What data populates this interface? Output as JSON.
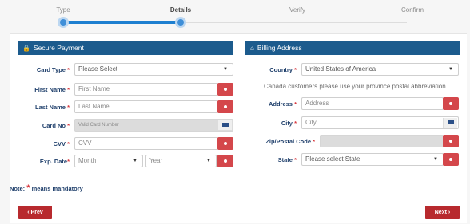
{
  "stepper": {
    "steps": [
      {
        "label": "Type"
      },
      {
        "label": "Details"
      },
      {
        "label": "Verify"
      },
      {
        "label": "Confirm"
      }
    ]
  },
  "payment": {
    "header": "Secure Payment",
    "card_type": {
      "label": "Card Type",
      "value": "Please Select"
    },
    "first_name": {
      "label": "First Name",
      "placeholder": "First Name"
    },
    "last_name": {
      "label": "Last Name",
      "placeholder": "Last Name"
    },
    "card_no": {
      "label": "Card No",
      "placeholder": "Valid Card Number"
    },
    "cvv": {
      "label": "CVV",
      "placeholder": "CVV"
    },
    "exp_date": {
      "label": "Exp. Date",
      "month": "Month",
      "year": "Year"
    }
  },
  "billing": {
    "header": "Billing Address",
    "country": {
      "label": "Country",
      "value": "United States of America"
    },
    "hint": "Canada customers please use your province postal abbreviation",
    "address": {
      "label": "Address",
      "placeholder": "Address"
    },
    "city": {
      "label": "City",
      "placeholder": "City"
    },
    "zip": {
      "label": "Zip/Postal Code"
    },
    "state": {
      "label": "State",
      "value": "Please select State"
    }
  },
  "note": {
    "prefix": "Note:",
    "star": "*",
    "suffix": "means mandatory"
  },
  "nav": {
    "prev": "Prev",
    "next": "Next"
  },
  "colors": {
    "accent": "#1c5b8d",
    "error": "#d4474b",
    "button": "#b82a2e",
    "progress": "#1e7fd0"
  }
}
